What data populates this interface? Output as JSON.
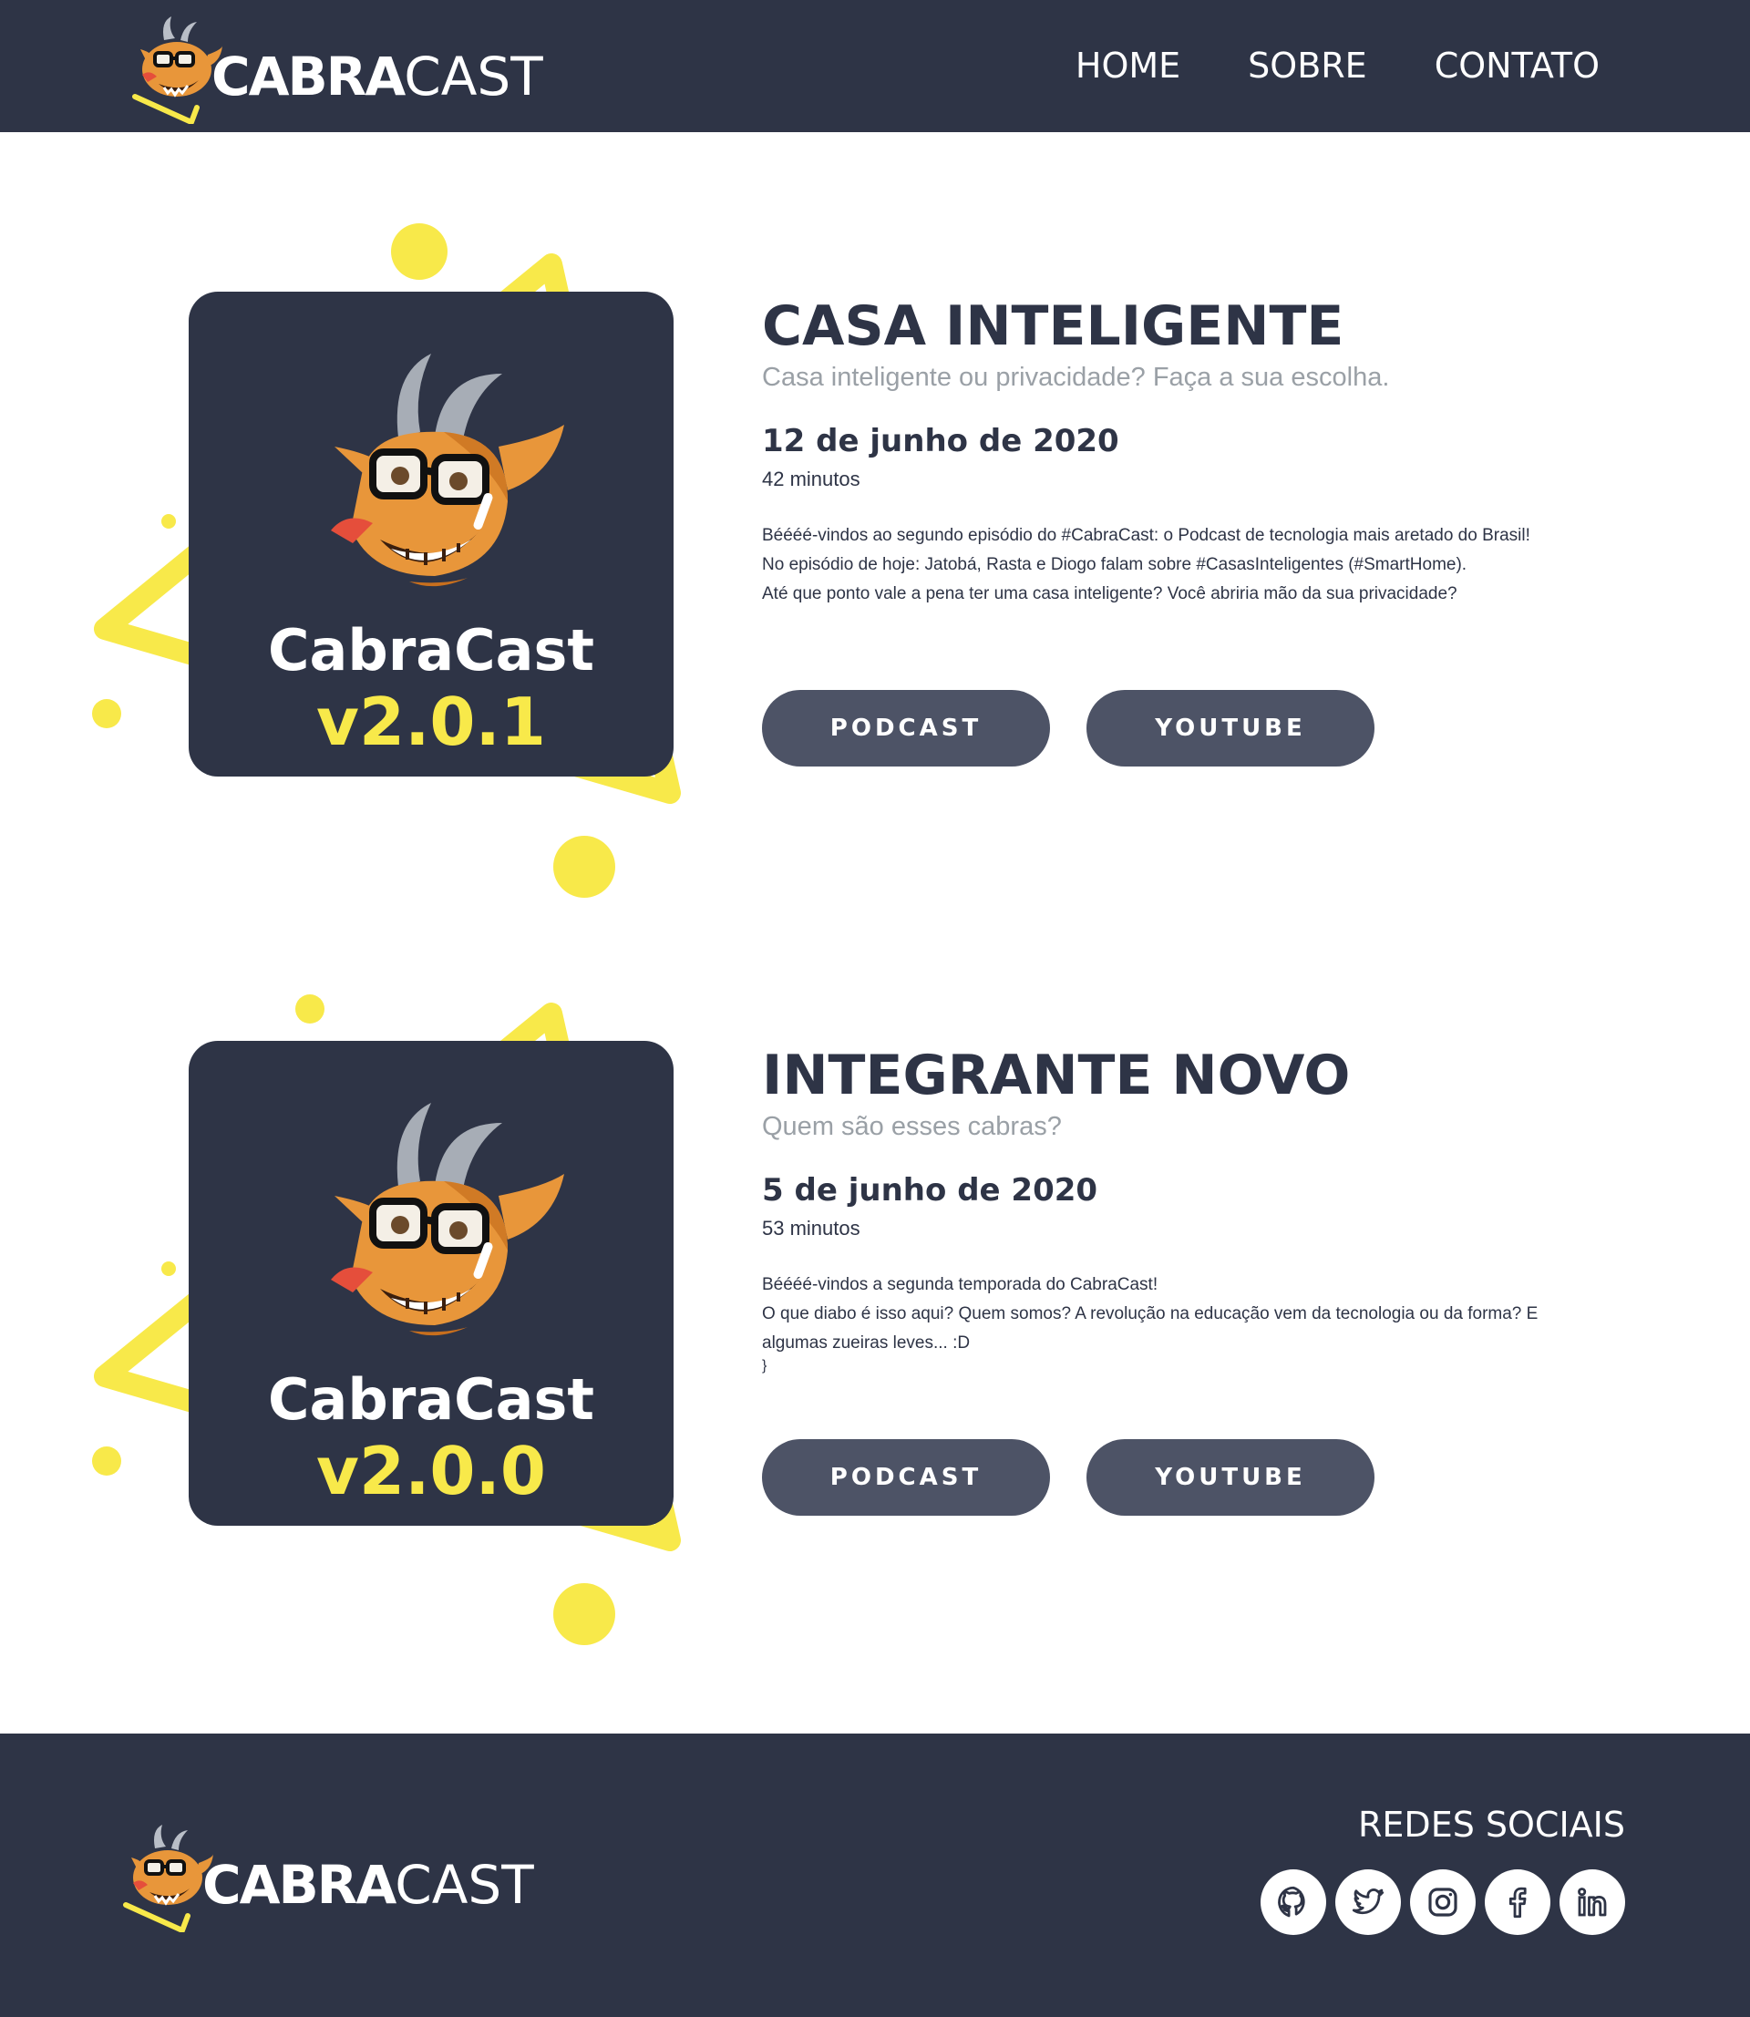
{
  "header": {
    "logo": {
      "bold": "CABRA",
      "light": "CAST"
    },
    "nav": [
      "HOME",
      "SOBRE",
      "CONTATO"
    ]
  },
  "episodes": [
    {
      "cover_name": "CabraCast",
      "cover_version": "v2.0.1",
      "title": "CASA INTELIGENTE",
      "subtitle": "Casa inteligente ou privacidade? Faça a sua escolha.",
      "date": "12 de junho de 2020",
      "duration": "42 minutos",
      "description": [
        "Béééé-vindos ao segundo episódio do #CabraCast: o Podcast de tecnologia mais aretado do Brasil!",
        "No episódio de hoje: Jatobá, Rasta e Diogo falam sobre #CasasInteligentes (#SmartHome).",
        "Até que ponto vale a pena ter uma casa inteligente? Você abriria mão da sua privacidade?"
      ],
      "buttons": [
        "PODCAST",
        "YOUTUBE"
      ]
    },
    {
      "cover_name": "CabraCast",
      "cover_version": "v2.0.0",
      "title": "INTEGRANTE NOVO",
      "subtitle": "Quem são esses cabras?",
      "date": "5 de junho de 2020",
      "duration": "53 minutos",
      "description": [
        "Béééé-vindos a segunda temporada do CabraCast!",
        "O que diabo é isso aqui? Quem somos? A revolução na educação vem da tecnologia ou da forma? E algumas zueiras leves... :D"
      ],
      "buttons": [
        "PODCAST",
        "YOUTUBE"
      ]
    }
  ],
  "footer": {
    "logo": {
      "bold": "CABRA",
      "light": "CAST"
    },
    "social_title": "REDES SOCIAIS",
    "social_icons": [
      "github-icon",
      "twitter-icon",
      "instagram-icon",
      "facebook-icon",
      "linkedin-icon"
    ]
  },
  "colors": {
    "navy": "#2e3446",
    "button": "#4d5366",
    "accent_yellow": "#f8e94a",
    "goat_orange": "#e8963a",
    "subtitle_gray": "#9aa0a6"
  }
}
